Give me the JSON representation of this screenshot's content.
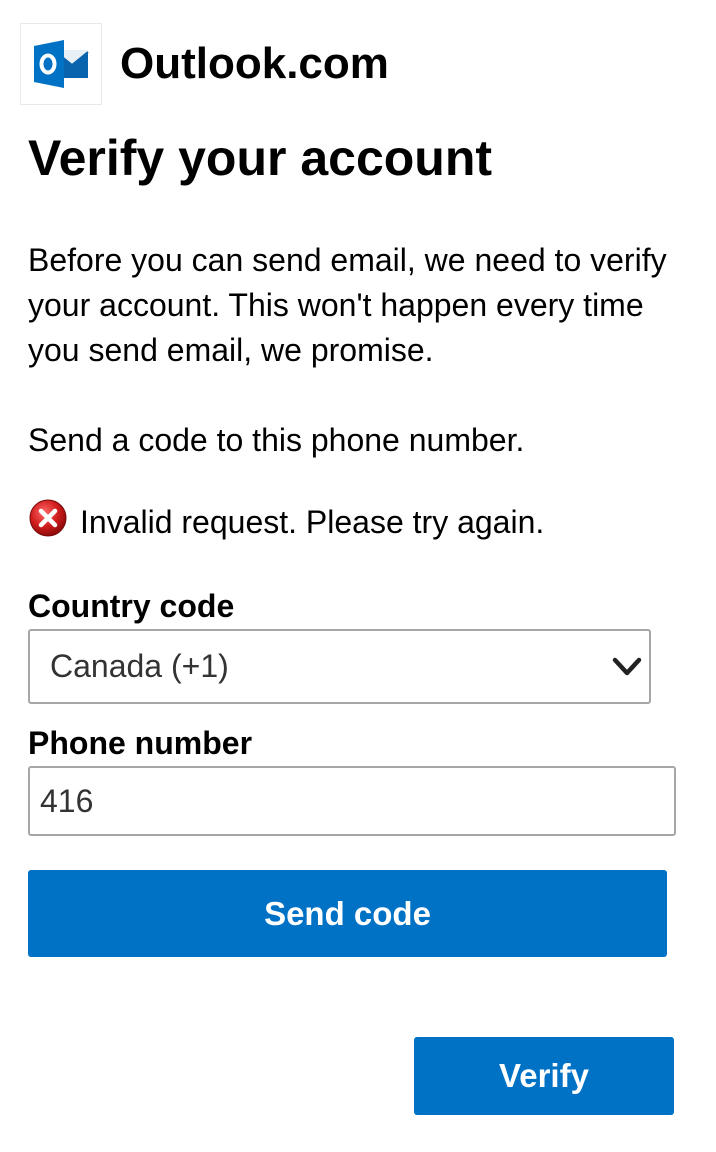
{
  "header": {
    "logo_icon": "outlook-logo-icon",
    "app_name": "Outlook.com"
  },
  "page": {
    "title": "Verify your account",
    "description": "Before you can send email, we need to verify your account. This won't happen every time you send email, we promise.",
    "instruction": "Send a code to this phone number."
  },
  "error": {
    "icon": "error-x-icon",
    "message": "Invalid request. Please try again.",
    "color": "#d01c1c"
  },
  "form": {
    "country_label": "Country code",
    "country_value": "Canada (+1)",
    "phone_label": "Phone number",
    "phone_value": "416"
  },
  "buttons": {
    "send_code": "Send code",
    "verify": "Verify"
  },
  "colors": {
    "accent": "#0072c6",
    "border": "#a6a6a6",
    "text": "#000000"
  }
}
